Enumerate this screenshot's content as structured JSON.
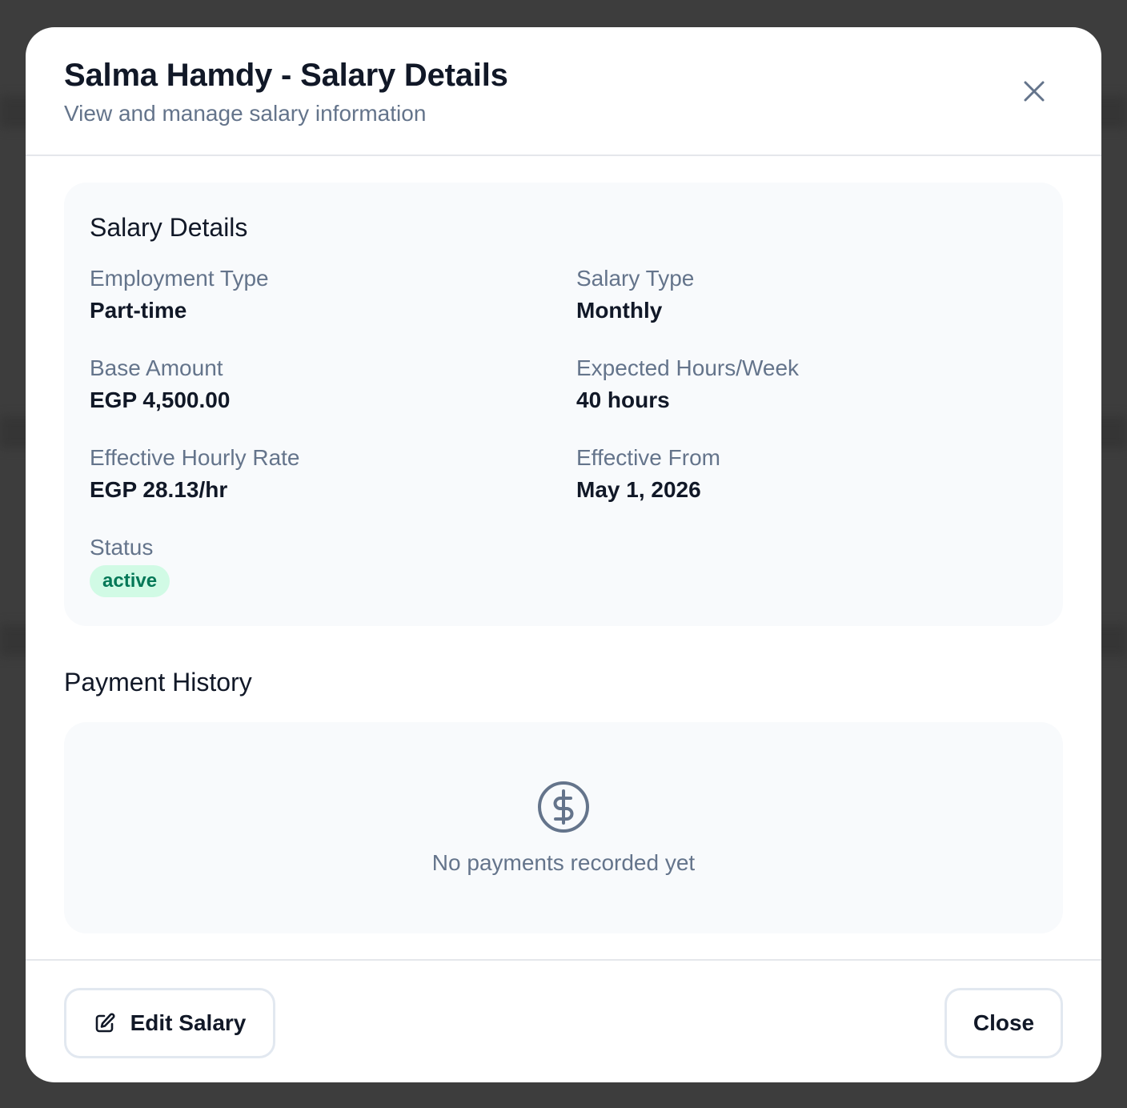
{
  "dialog": {
    "title": "Salma Hamdy - Salary Details",
    "subtitle": "View and manage salary information",
    "close_icon": "close-icon"
  },
  "salary_details": {
    "title": "Salary Details",
    "fields": {
      "employment_type": {
        "label": "Employment Type",
        "value": "Part-time"
      },
      "salary_type": {
        "label": "Salary Type",
        "value": "Monthly"
      },
      "base_amount": {
        "label": "Base Amount",
        "value": "EGP 4,500.00"
      },
      "expected_hours": {
        "label": "Expected Hours/Week",
        "value": "40 hours"
      },
      "hourly_rate": {
        "label": "Effective Hourly Rate",
        "value": "EGP 28.13/hr"
      },
      "effective_from": {
        "label": "Effective From",
        "value": "May 1, 2026"
      },
      "status": {
        "label": "Status",
        "value": "active"
      }
    }
  },
  "payment_history": {
    "title": "Payment History",
    "empty_icon": "dollar-circle-icon",
    "empty_text": "No payments recorded yet"
  },
  "footer": {
    "edit_label": "Edit Salary",
    "edit_icon": "edit-icon",
    "close_label": "Close"
  },
  "colors": {
    "backdrop": "#3d3d3d",
    "card_background": "#f8fafc",
    "muted_text": "#64748b",
    "badge_background": "#d1fae5",
    "badge_text": "#047857"
  }
}
